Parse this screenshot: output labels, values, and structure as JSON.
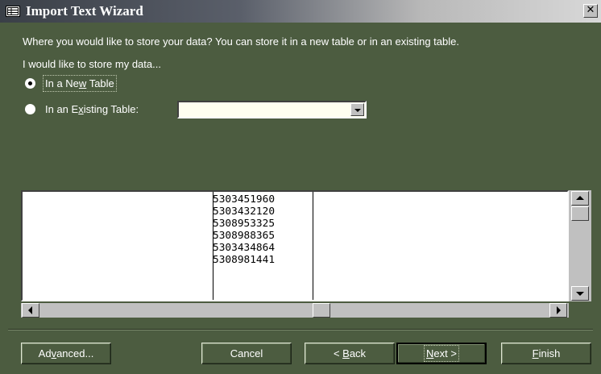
{
  "window": {
    "title": "Import Text Wizard",
    "close_glyph": "✕"
  },
  "content": {
    "question": "Where you would like to store your data?  You can store it in a new table or in an existing table.",
    "prompt": "I would like to store my data...",
    "options": [
      {
        "label": "In a New Table",
        "checked": true
      },
      {
        "label": "In an Existing Table:",
        "checked": false
      }
    ],
    "existing_table_value": ""
  },
  "preview": {
    "column2_values": [
      "5303451960",
      "5303432120",
      "5308953325",
      "5308988365",
      "5303434864",
      "5308981441"
    ]
  },
  "buttons": {
    "advanced": "Advanced...",
    "cancel": "Cancel",
    "back": "< Back",
    "next": "Next >",
    "finish": "Finish"
  },
  "colors": {
    "dialog_bg": "#4c5c40",
    "field_bg": "#ffffff"
  },
  "icons": {
    "title": "table-icon",
    "close": "close-icon",
    "dropdown": "chevron-down-icon"
  }
}
